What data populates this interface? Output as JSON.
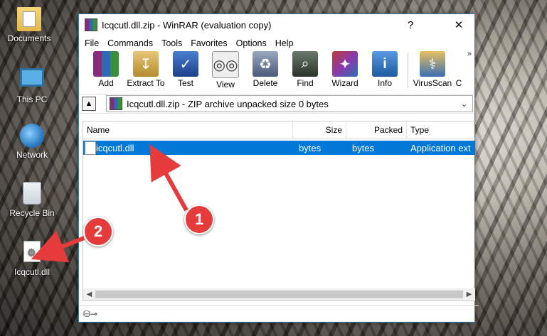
{
  "desktop": {
    "icons": [
      {
        "label": "Documents",
        "icon": "documents-folder-icon"
      },
      {
        "label": "This PC",
        "icon": "computer-icon"
      },
      {
        "label": "Network",
        "icon": "network-icon"
      },
      {
        "label": "Recycle Bin",
        "icon": "recycle-bin-icon"
      },
      {
        "label": "Icqcutl.dll",
        "icon": "dll-file-icon"
      }
    ]
  },
  "window": {
    "title": "Icqcutl.dll.zip - WinRAR (evaluation copy)",
    "help_button": "?",
    "close_button": "✕",
    "menu": [
      "File",
      "Commands",
      "Tools",
      "Favorites",
      "Options",
      "Help"
    ],
    "toolbar": [
      {
        "label": "Add",
        "icon": "add-archive-icon",
        "color": "#7a3a8a"
      },
      {
        "label": "Extract To",
        "icon": "extract-icon",
        "color": "#b58a2d"
      },
      {
        "label": "Test",
        "icon": "test-icon",
        "color": "#2d5fb5"
      },
      {
        "label": "View",
        "icon": "view-icon",
        "color": "#8a8a8a"
      },
      {
        "label": "Delete",
        "icon": "delete-icon",
        "color": "#5a6a8a"
      },
      {
        "label": "Find",
        "icon": "find-icon",
        "color": "#3a4a3a"
      },
      {
        "label": "Wizard",
        "icon": "wizard-icon",
        "color": "#8a3aaa"
      },
      {
        "label": "Info",
        "icon": "info-icon",
        "color": "#2d6fb5"
      },
      {
        "label": "VirusScan",
        "icon": "virus-scan-icon",
        "color": "#3a6fb5"
      },
      {
        "label": "C",
        "icon": "comment-icon",
        "color": "#ffffff"
      }
    ],
    "toolbar_more": "»",
    "address": "Icqcutl.dll.zip - ZIP archive unpacked size 0 bytes",
    "columns": {
      "name": "Name",
      "size": "Size",
      "packed": "Packed",
      "type": "Type"
    },
    "files": [
      {
        "name": "icqcutl.dll",
        "size": "bytes",
        "packed": "bytes",
        "type": "Application ext"
      }
    ]
  },
  "annotations": {
    "badge1": "1",
    "badge2": "2",
    "arrow_color": "#e53b3b"
  }
}
